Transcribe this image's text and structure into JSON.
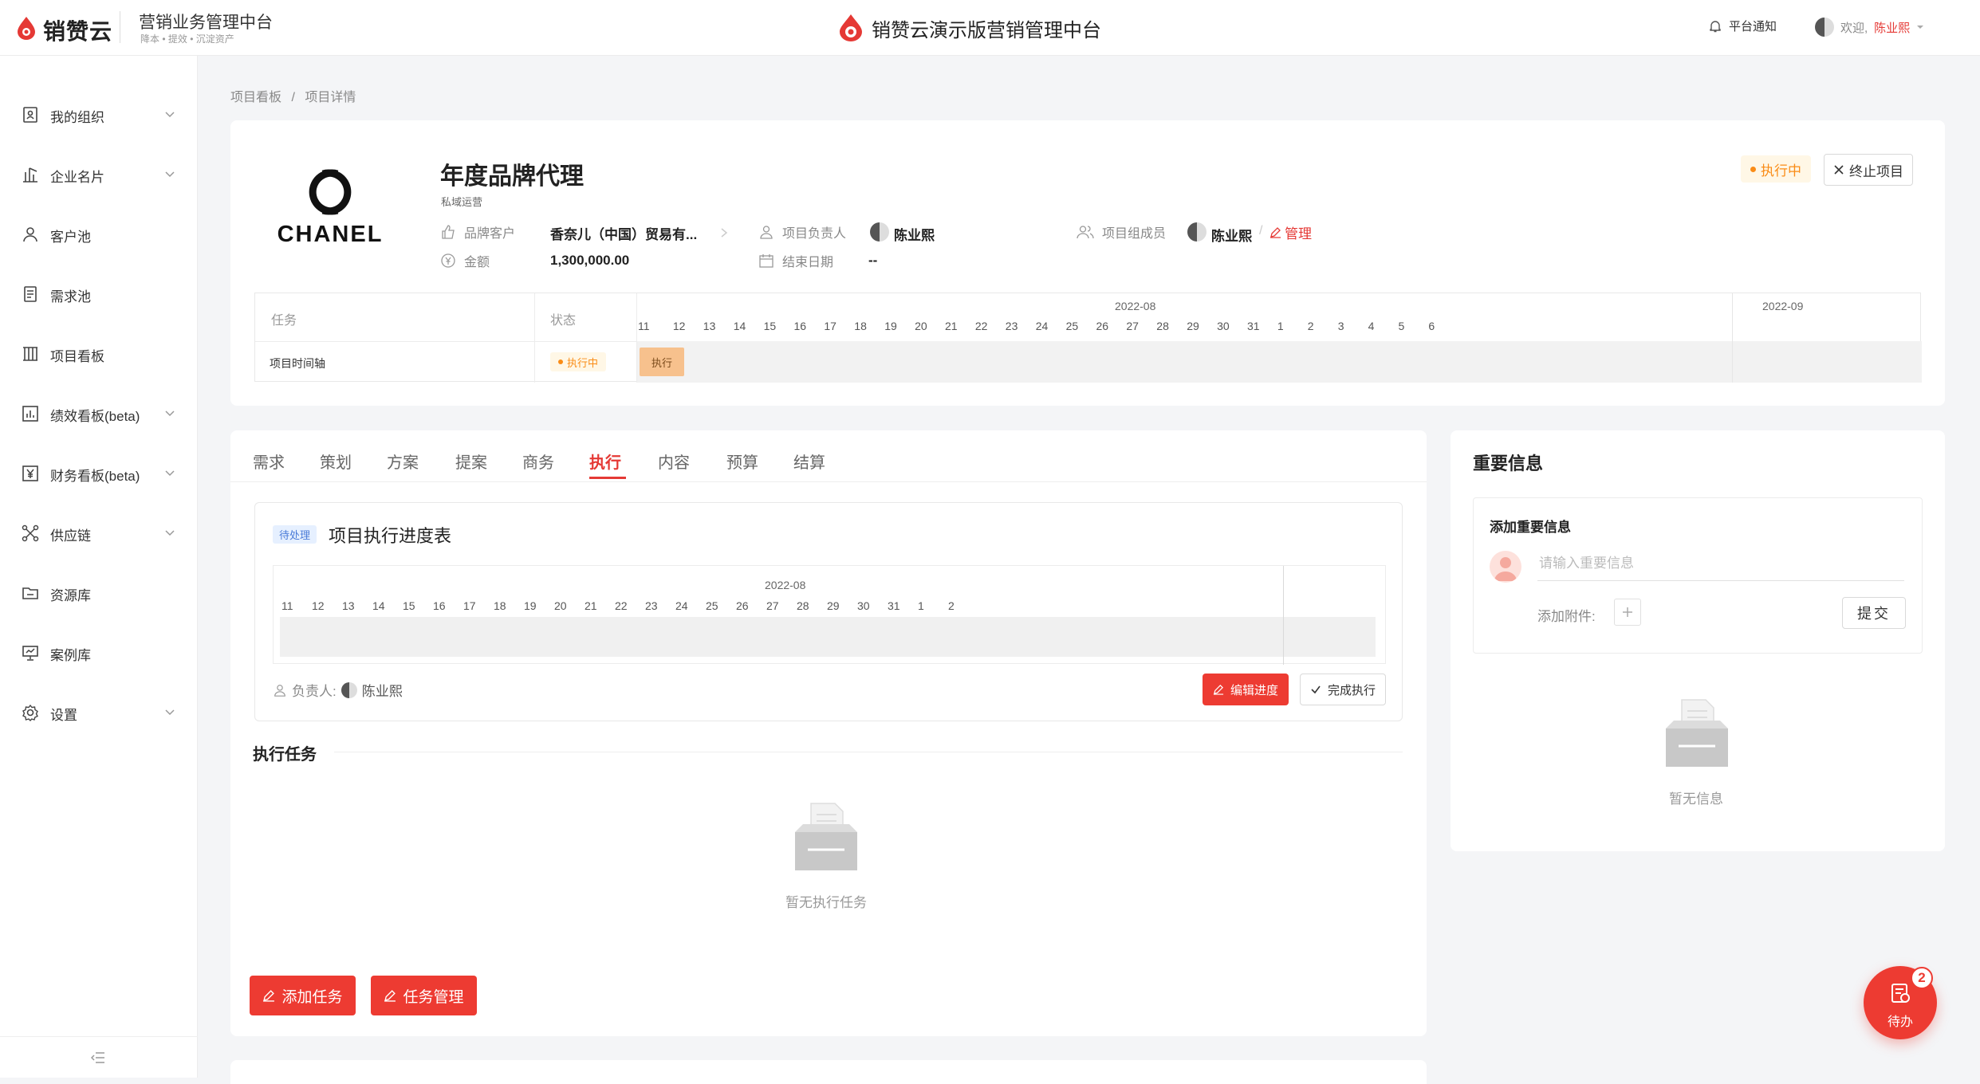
{
  "header": {
    "brand": "销赞云",
    "title": "营销业务管理中台",
    "subtitle": "降本 • 提效 • 沉淀资产",
    "center_title": "销赞云演示版营销管理中台",
    "notify": "平台通知",
    "welcome": "欢迎,",
    "username": "陈业熙"
  },
  "sidebar": {
    "items": [
      {
        "label": "我的组织",
        "icon": "org-icon",
        "expandable": true
      },
      {
        "label": "企业名片",
        "icon": "building-icon",
        "expandable": true
      },
      {
        "label": "客户池",
        "icon": "user-icon",
        "expandable": false
      },
      {
        "label": "需求池",
        "icon": "clipboard-icon",
        "expandable": false
      },
      {
        "label": "项目看板",
        "icon": "board-icon",
        "expandable": false
      },
      {
        "label": "绩效看板(beta)",
        "icon": "chart-icon",
        "expandable": true
      },
      {
        "label": "财务看板(beta)",
        "icon": "yen-icon",
        "expandable": true
      },
      {
        "label": "供应链",
        "icon": "network-icon",
        "expandable": true
      },
      {
        "label": "资源库",
        "icon": "folder-icon",
        "expandable": false
      },
      {
        "label": "案例库",
        "icon": "presentation-icon",
        "expandable": false
      },
      {
        "label": "设置",
        "icon": "gear-icon",
        "expandable": true
      }
    ]
  },
  "breadcrumb": {
    "root": "项目看板",
    "sep": "/",
    "current": "项目详情"
  },
  "project": {
    "logo_text": "CHANEL",
    "title": "年度品牌代理",
    "subtitle": "私域运营",
    "status": "执行中",
    "stop_label": "终止项目",
    "fields": {
      "brand_client_label": "品牌客户",
      "brand_client_value": "香奈儿（中国）贸易有...",
      "amount_label": "金额",
      "amount_value": "1,300,000.00",
      "owner_label": "项目负责人",
      "owner_value": "陈业熙",
      "end_date_label": "结束日期",
      "end_date_value": "--",
      "members_label": "项目组成员",
      "members_value": "陈业熙",
      "manage_label": "管理"
    }
  },
  "timeline": {
    "head_task": "任务",
    "head_status": "状态",
    "month1": "2022-08",
    "month2": "2022-09",
    "days_aug": [
      "11",
      "12",
      "13",
      "14",
      "15",
      "16",
      "17",
      "18",
      "19",
      "20",
      "21",
      "22",
      "23",
      "24",
      "25",
      "26",
      "27",
      "28",
      "29",
      "30",
      "31"
    ],
    "days_sep": [
      "1",
      "2",
      "3",
      "4",
      "5",
      "6"
    ],
    "row_label": "项目时间轴",
    "row_status": "执行中",
    "bar_label": "执行"
  },
  "tabs": {
    "items": [
      "需求",
      "策划",
      "方案",
      "提案",
      "商务",
      "执行",
      "内容",
      "预算",
      "结算"
    ],
    "active": "执行"
  },
  "schedule": {
    "badge": "待处理",
    "title": "项目执行进度表",
    "month": "2022-08",
    "days": [
      "11",
      "12",
      "13",
      "14",
      "15",
      "16",
      "17",
      "18",
      "19",
      "20",
      "21",
      "22",
      "23",
      "24",
      "25",
      "26",
      "27",
      "28",
      "29",
      "30",
      "31",
      "1",
      "2"
    ],
    "owner_label": "负责人:",
    "owner_value": "陈业熙",
    "edit_label": "编辑进度",
    "complete_label": "完成执行"
  },
  "tasks": {
    "title": "执行任务",
    "empty": "暂无执行任务",
    "add_label": "添加任务",
    "manage_label": "任务管理"
  },
  "info": {
    "title": "重要信息",
    "box_title": "添加重要信息",
    "placeholder": "请输入重要信息",
    "attach_label": "添加附件:",
    "submit_label": "提交",
    "empty": "暂无信息"
  },
  "todo": {
    "label": "待办",
    "count": "2"
  },
  "colors": {
    "accent": "#ed3b32",
    "status_orange": "#fa8c16",
    "bar_fill": "#f7c18d"
  }
}
